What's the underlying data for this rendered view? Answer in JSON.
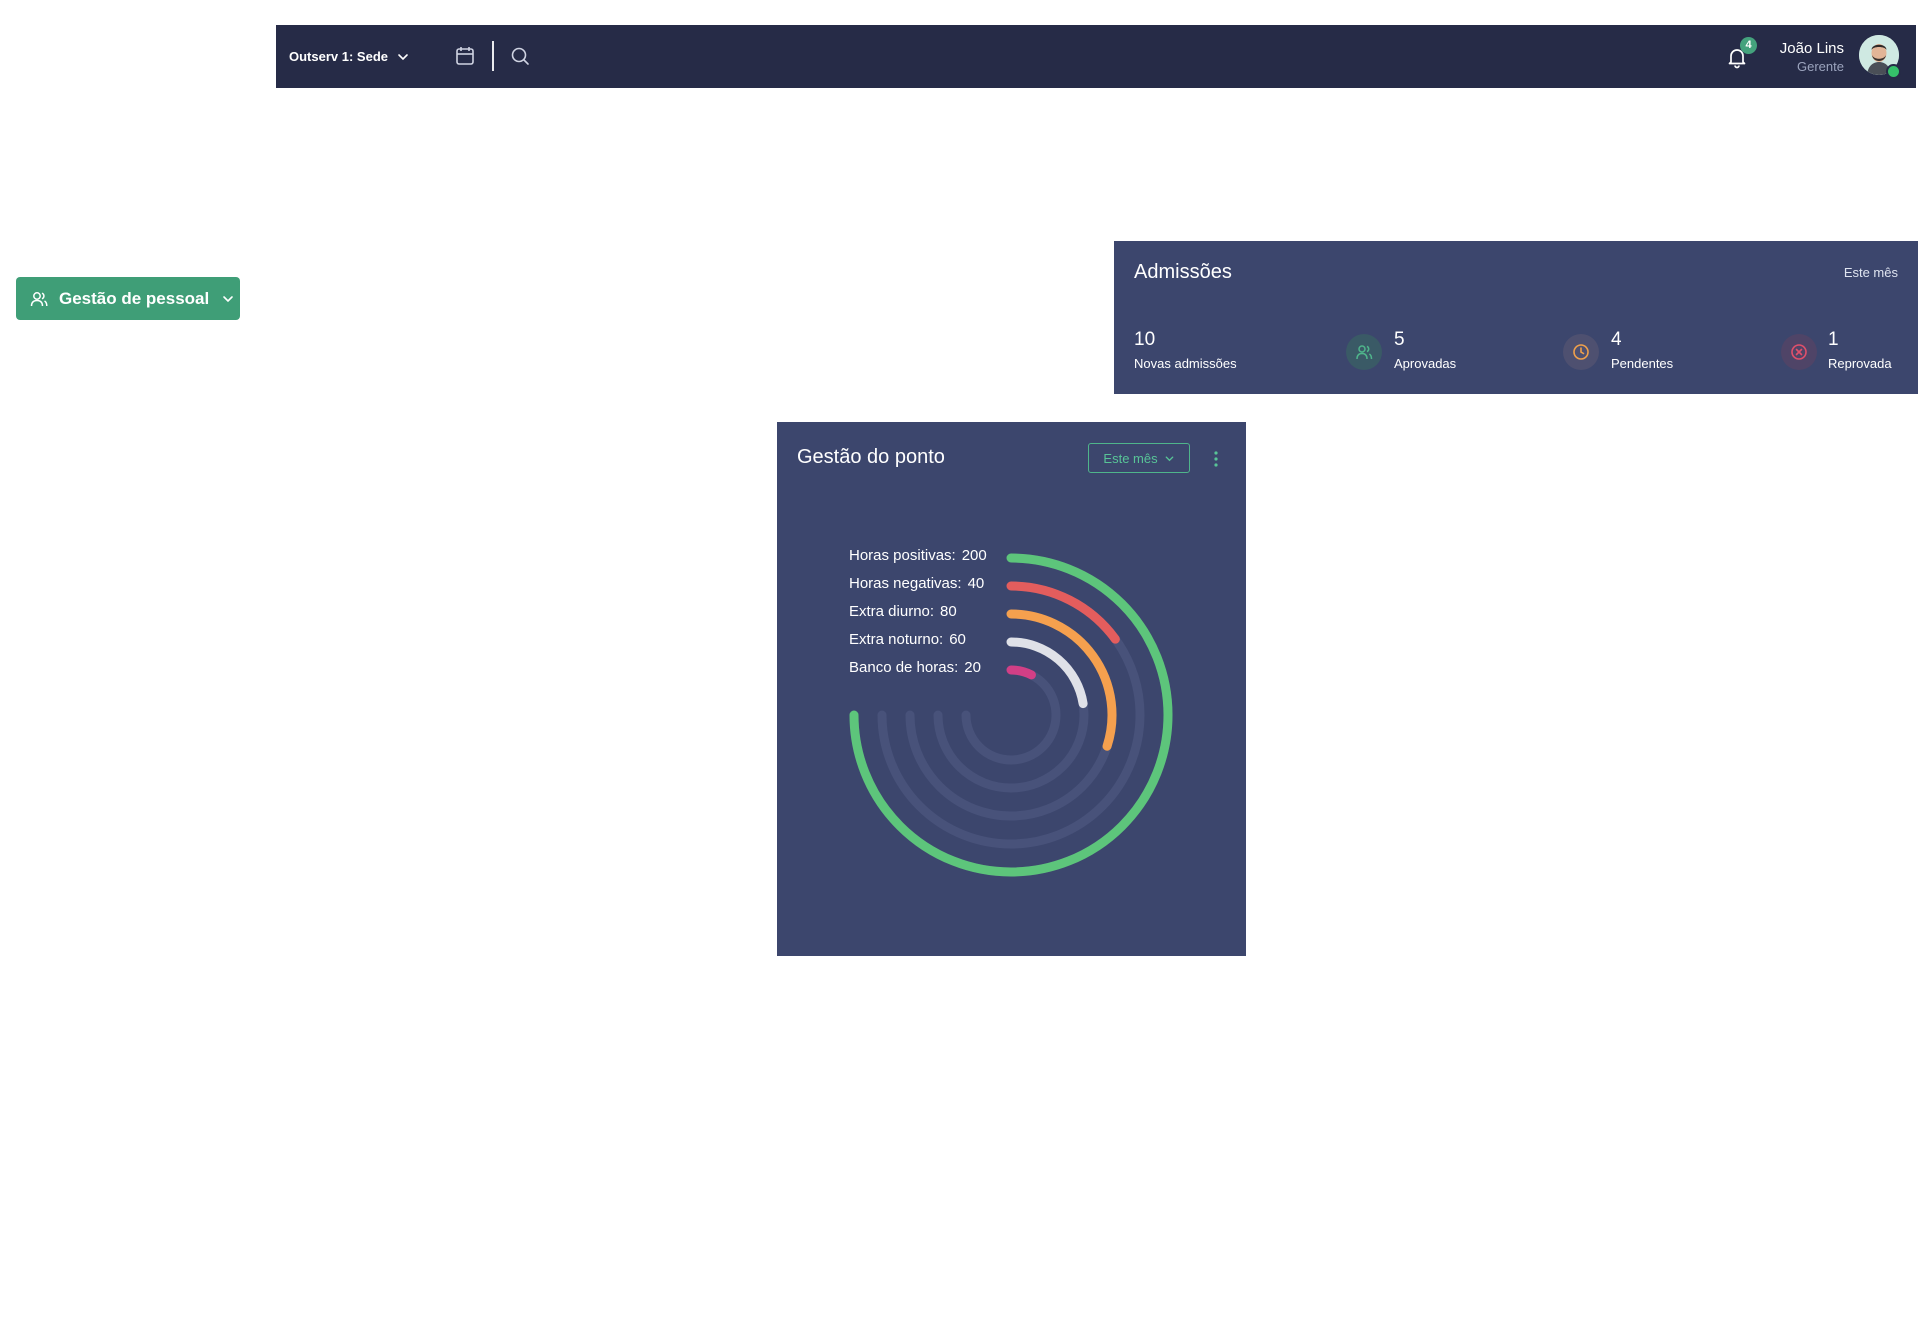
{
  "topbar": {
    "company_label": "Outserv 1: Sede",
    "notification_count": "4",
    "user_name": "João Lins",
    "user_role": "Gerente"
  },
  "sidebar": {
    "staff_button_label": "Gestão de pessoal"
  },
  "admissions": {
    "title": "Admissões",
    "period": "Este mês",
    "stats": [
      {
        "value": "10",
        "label": "Novas admissões"
      },
      {
        "value": "5",
        "label": "Aprovadas",
        "icon": "users-icon",
        "color": "#4fb58b"
      },
      {
        "value": "4",
        "label": "Pendentes",
        "icon": "clock-icon",
        "color": "#f0a04b"
      },
      {
        "value": "1",
        "label": "Reprovada",
        "icon": "x-circle-icon",
        "color": "#e0506b"
      }
    ]
  },
  "ponto": {
    "title": "Gestão do ponto",
    "period_select": "Este mês"
  },
  "chart_data": {
    "type": "radial-bar",
    "title": "Gestão do ponto",
    "max": 200,
    "series": [
      {
        "name": "Horas positivas:",
        "value": 200,
        "color": "#5dc57b"
      },
      {
        "name": "Horas negativas:",
        "value": 40,
        "color": "#e35d5d"
      },
      {
        "name": "Extra diurno:",
        "value": 80,
        "color": "#f5a04e"
      },
      {
        "name": "Extra noturno:",
        "value": 60,
        "color": "#dfe1e8"
      },
      {
        "name": "Banco de horas:",
        "value": 20,
        "color": "#d23f86"
      }
    ],
    "track_color": "#48527a"
  }
}
